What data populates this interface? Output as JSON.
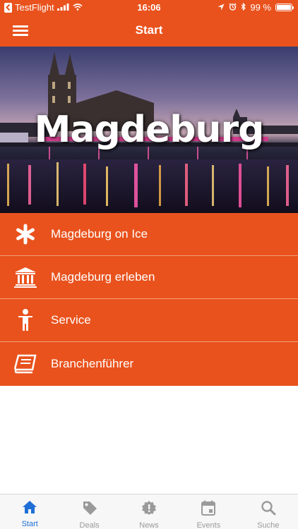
{
  "status_bar": {
    "back_app": "TestFlight",
    "time": "16:06",
    "battery": "99 %",
    "battery_level": 0.99
  },
  "nav": {
    "title": "Start",
    "menu_icon": "hamburger-icon"
  },
  "hero": {
    "title": "Magdeburg"
  },
  "menu": {
    "items": [
      {
        "label": "Magdeburg on Ice",
        "icon": "snowflake-icon"
      },
      {
        "label": "Magdeburg erleben",
        "icon": "museum-icon"
      },
      {
        "label": "Service",
        "icon": "person-icon"
      },
      {
        "label": "Branchenführer",
        "icon": "book-icon"
      }
    ]
  },
  "tabs": [
    {
      "label": "Start",
      "icon": "home-icon",
      "active": true
    },
    {
      "label": "Deals",
      "icon": "tag-icon",
      "active": false
    },
    {
      "label": "News",
      "icon": "alert-badge-icon",
      "active": false
    },
    {
      "label": "Events",
      "icon": "calendar-icon",
      "active": false
    },
    {
      "label": "Suche",
      "icon": "search-icon",
      "active": false
    }
  ],
  "colors": {
    "accent": "#e9521d",
    "tab_active": "#1f6fd6",
    "tab_inactive": "#9a9a9a"
  }
}
